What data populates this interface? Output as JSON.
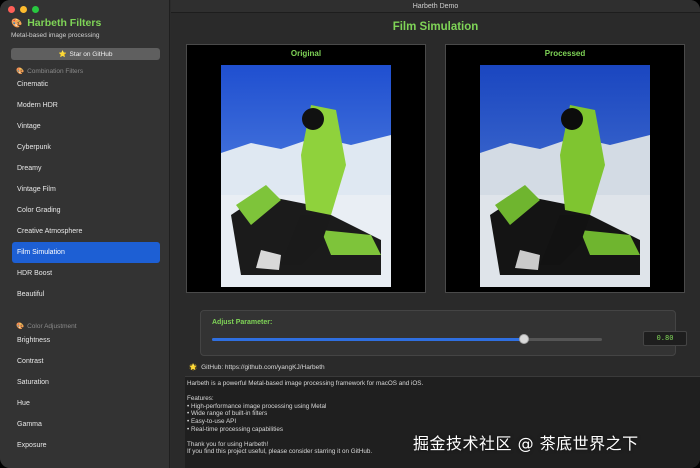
{
  "window": {
    "title": "Harbeth Demo"
  },
  "sidebar": {
    "app_title": "Harbeth Filters",
    "app_subtitle": "Metal-based image processing",
    "star_button": "Star on GitHub",
    "sections": [
      {
        "title": "Combination Filters",
        "items": [
          "Cinematic",
          "Modern HDR",
          "Vintage",
          "Cyberpunk",
          "Dreamy",
          "Vintage Film",
          "Color Grading",
          "Creative Atmosphere",
          "Film Simulation",
          "HDR Boost",
          "Beautiful"
        ]
      },
      {
        "title": "Color Adjustment",
        "items": [
          "Brightness",
          "Contrast",
          "Saturation",
          "Hue",
          "Gamma",
          "Exposure"
        ]
      }
    ],
    "selected": "Film Simulation"
  },
  "main": {
    "page_title": "Film Simulation",
    "original_label": "Original",
    "processed_label": "Processed",
    "param": {
      "label": "Adjust Parameter:",
      "value_text": "0.80",
      "fraction": 0.8
    },
    "github_text": "GitHub: https://github.com/yangKJ/Harbeth",
    "description": "Harbeth is a powerful Metal-based image processing framework for macOS and iOS.\n\nFeatures:\n• High-performance image processing using Metal\n• Wide range of built-in filters\n• Easy-to-use API\n• Real-time processing capabilities\n\nThank you for using Harbeth!\nIf you find this project useful, please consider starring it on GitHub."
  },
  "watermark": "掘金技术社区 @ 茶底世界之下",
  "colors": {
    "accent_green": "#7fd457",
    "selection_blue": "#1d5fd4",
    "slider_blue": "#2f6fe0"
  },
  "icons": {
    "app_icon": "palette-icon",
    "star_icon": "star-icon",
    "section_icon": "palette-icon",
    "github_icon": "sun-icon"
  }
}
